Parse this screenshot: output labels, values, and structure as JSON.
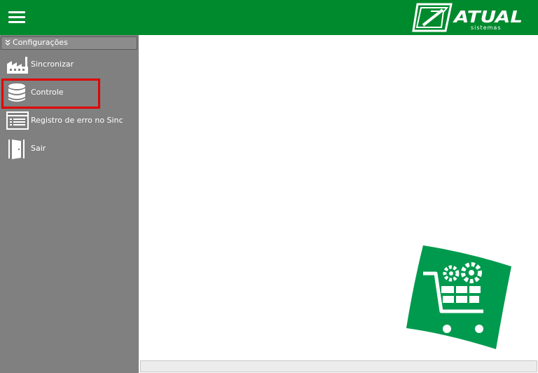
{
  "header": {
    "menu_icon": "hamburger-icon",
    "logo_icon": "atual-sistemas-logo",
    "brand_name": "ATUAL",
    "brand_tagline": "sistemas",
    "color": "#008a2e"
  },
  "sidebar": {
    "section_label": "Configurações",
    "section_icon": "double-chevron-down-icon",
    "items": [
      {
        "label": "Sincronizar",
        "icon": "factory-icon"
      },
      {
        "label": "Controle",
        "icon": "database-icon",
        "highlighted": true
      },
      {
        "label": "Registro de erro no Sinc",
        "icon": "log-list-icon"
      },
      {
        "label": "Sair",
        "icon": "exit-door-icon"
      }
    ],
    "background": "#808080",
    "highlight_color": "#e00000"
  },
  "main": {
    "badge_icon": "shopping-cart-gears-icon",
    "badge_color": "#009a4e"
  }
}
